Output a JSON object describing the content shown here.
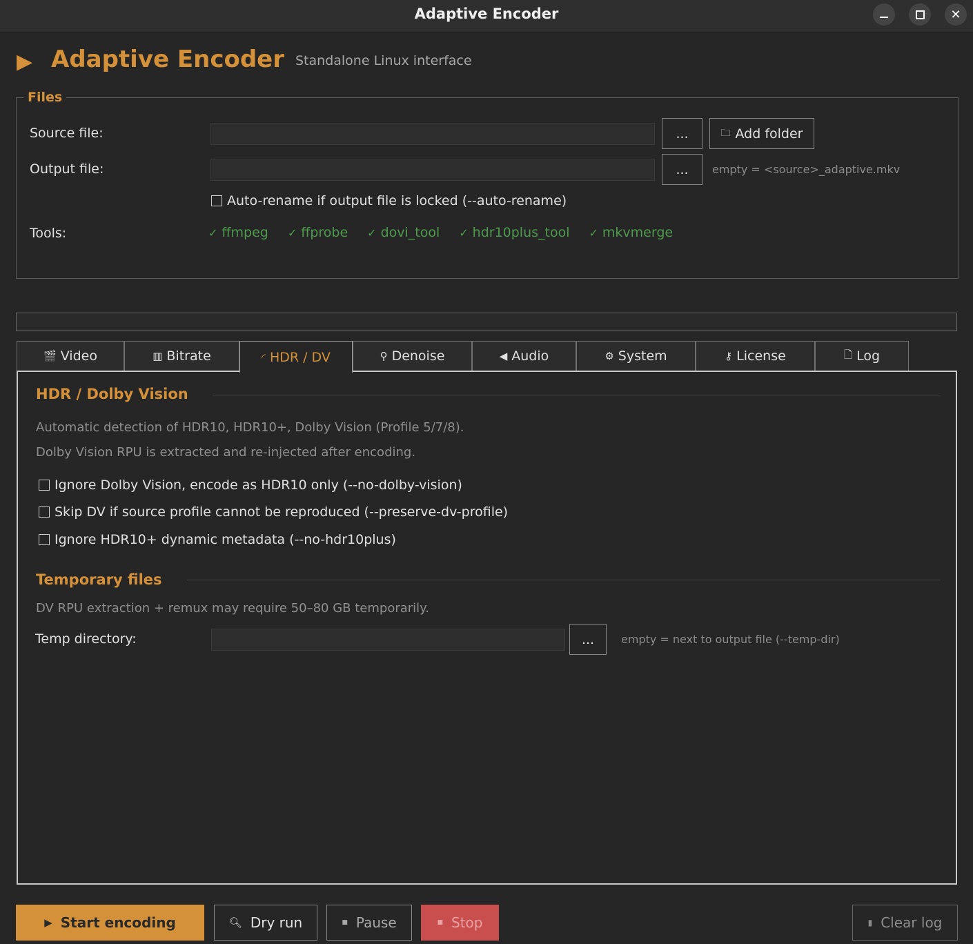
{
  "window": {
    "title": "Adaptive Encoder"
  },
  "header": {
    "title": "Adaptive Encoder",
    "subtitle": "Standalone Linux interface"
  },
  "files": {
    "legend": "Files",
    "source_label": "Source file:",
    "source_value": "",
    "browse_label": "...",
    "add_folder_label": "Add folder",
    "output_label": "Output file:",
    "output_value": "",
    "output_hint": "empty = <source>_adaptive.mkv",
    "auto_rename_label": "Auto-rename if output file is locked  (--auto-rename)",
    "tools_label": "Tools:",
    "tools": [
      "ffmpeg",
      "ffprobe",
      "dovi_tool",
      "hdr10plus_tool",
      "mkvmerge"
    ]
  },
  "tabs": [
    {
      "label": "Video",
      "icon": "clapper-icon"
    },
    {
      "label": "Bitrate",
      "icon": "bar-chart-icon"
    },
    {
      "label": "HDR / DV",
      "icon": "rainbow-icon"
    },
    {
      "label": "Denoise",
      "icon": "broom-icon"
    },
    {
      "label": "Audio",
      "icon": "speaker-icon"
    },
    {
      "label": "System",
      "icon": "gear-icon"
    },
    {
      "label": "License",
      "icon": "key-icon"
    },
    {
      "label": "Log",
      "icon": "document-icon"
    }
  ],
  "active_tab": "HDR / DV",
  "hdr": {
    "title": "HDR / Dolby Vision",
    "desc1": "Automatic detection of HDR10, HDR10+, Dolby Vision (Profile 5/7/8).",
    "desc2": "Dolby Vision RPU is extracted and re-injected after encoding.",
    "options": [
      "Ignore Dolby Vision, encode as HDR10 only  (--no-dolby-vision)",
      "Skip DV if source profile cannot be reproduced  (--preserve-dv-profile)",
      "Ignore HDR10+ dynamic metadata  (--no-hdr10plus)"
    ]
  },
  "temp": {
    "title": "Temporary files",
    "desc": "DV RPU extraction + remux may require 50–80 GB temporarily.",
    "dir_label": "Temp directory:",
    "dir_value": "",
    "browse_label": "...",
    "hint": "empty = next to output file  (--temp-dir)"
  },
  "actions": {
    "start": "Start encoding",
    "dry_run": "Dry run",
    "pause": "Pause",
    "stop": "Stop",
    "clear_log": "Clear log"
  },
  "colors": {
    "accent": "#d4913a",
    "tool_ok": "#4e9a4e",
    "stop": "#c94f4f"
  }
}
